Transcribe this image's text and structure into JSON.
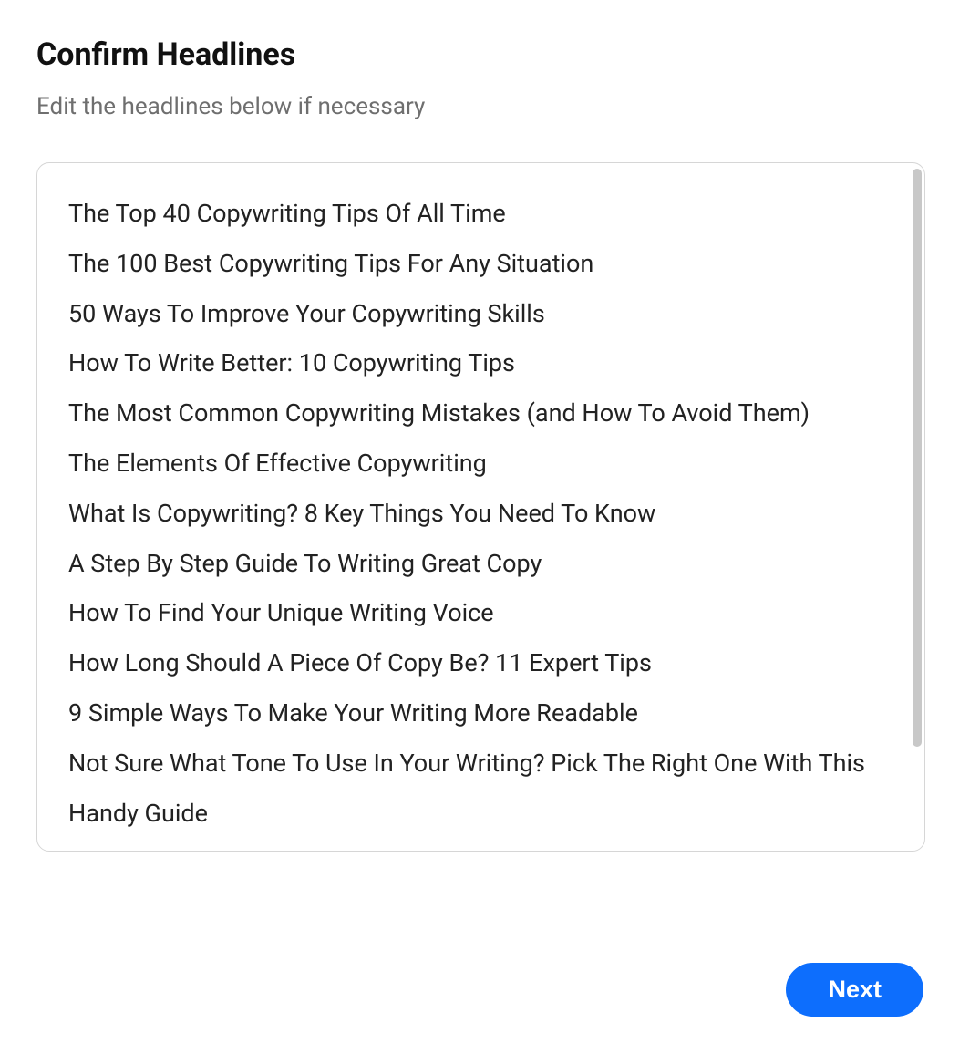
{
  "title": "Confirm Headlines",
  "subtitle": "Edit the headlines below if necessary",
  "headlines": [
    "The Top 40 Copywriting Tips Of All Time",
    "The 100 Best Copywriting Tips For Any Situation",
    "50 Ways To Improve Your Copywriting Skills",
    "How To Write Better: 10 Copywriting Tips",
    "The Most Common Copywriting Mistakes (and How To Avoid Them)",
    "The Elements Of Effective Copywriting",
    "What Is Copywriting? 8 Key Things You Need To Know",
    "A Step By Step Guide To Writing Great Copy",
    "How To Find Your Unique Writing Voice",
    "How Long Should A Piece Of Copy Be? 11 Expert Tips",
    "9 Simple Ways To Make Your Writing More Readable",
    "Not Sure What Tone To Use In Your Writing? Pick The Right One With This Handy Guide"
  ],
  "next_button_label": "Next"
}
